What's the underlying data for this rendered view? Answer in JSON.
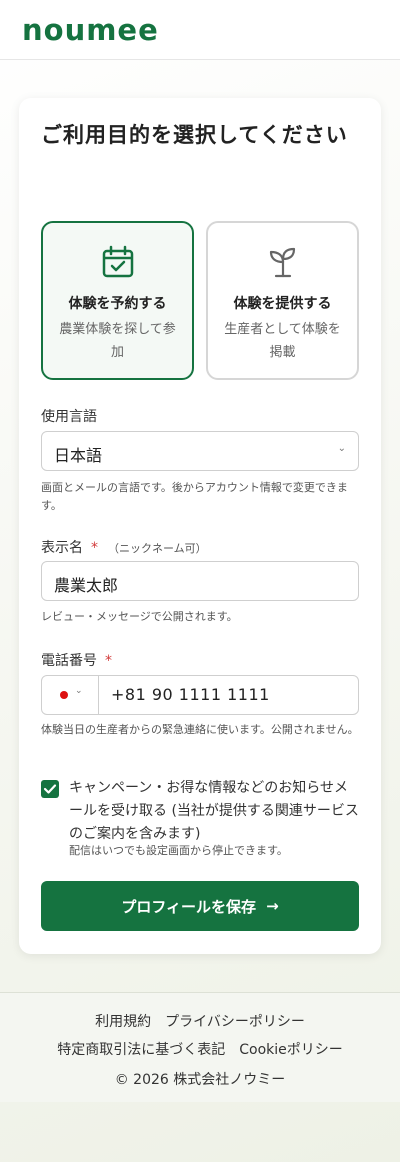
{
  "header": {
    "logo_text": "noumee"
  },
  "card": {
    "title": "ご利用目的を選択してください"
  },
  "purposes": [
    {
      "title": "体験を予約する",
      "description": "農業体験を探して参加",
      "icon": "calendar-check-icon",
      "selected": true
    },
    {
      "title": "体験を提供する",
      "description": "生産者として体験を掲載",
      "icon": "sprout-icon",
      "selected": false
    }
  ],
  "language": {
    "label": "使用言語",
    "value": "日本語",
    "help": "画面とメールの言語です。後からアカウント情報で変更できます。"
  },
  "display_name": {
    "label": "表示名",
    "required_mark": "*",
    "note": "（ニックネーム可）",
    "value": "農業太郎",
    "help": "レビュー・メッセージで公開されます。"
  },
  "phone": {
    "label": "電話番号",
    "required_mark": "*",
    "country_flag": "japan-flag-icon",
    "value": "+81 90 1111 1111",
    "help": "体験当日の生産者からの緊急連絡に使います。公開されません。"
  },
  "consent": {
    "checked": true,
    "label": "キャンペーン・お得な情報などのお知らせメールを受け取る (当社が提供する関連サービスのご案内を含みます)",
    "note": "配信はいつでも設定画面から停止できます。"
  },
  "save_button": {
    "label": "プロフィールを保存"
  },
  "footer": {
    "links_row1": [
      "利用規約",
      "プライバシーポリシー"
    ],
    "links_row2": [
      "特定商取引法に基づく表記",
      "Cookieポリシー"
    ],
    "copyright": "© 2026 株式会社ノウミー"
  },
  "colors": {
    "brand": "#157340",
    "required": "#d23a3a"
  }
}
